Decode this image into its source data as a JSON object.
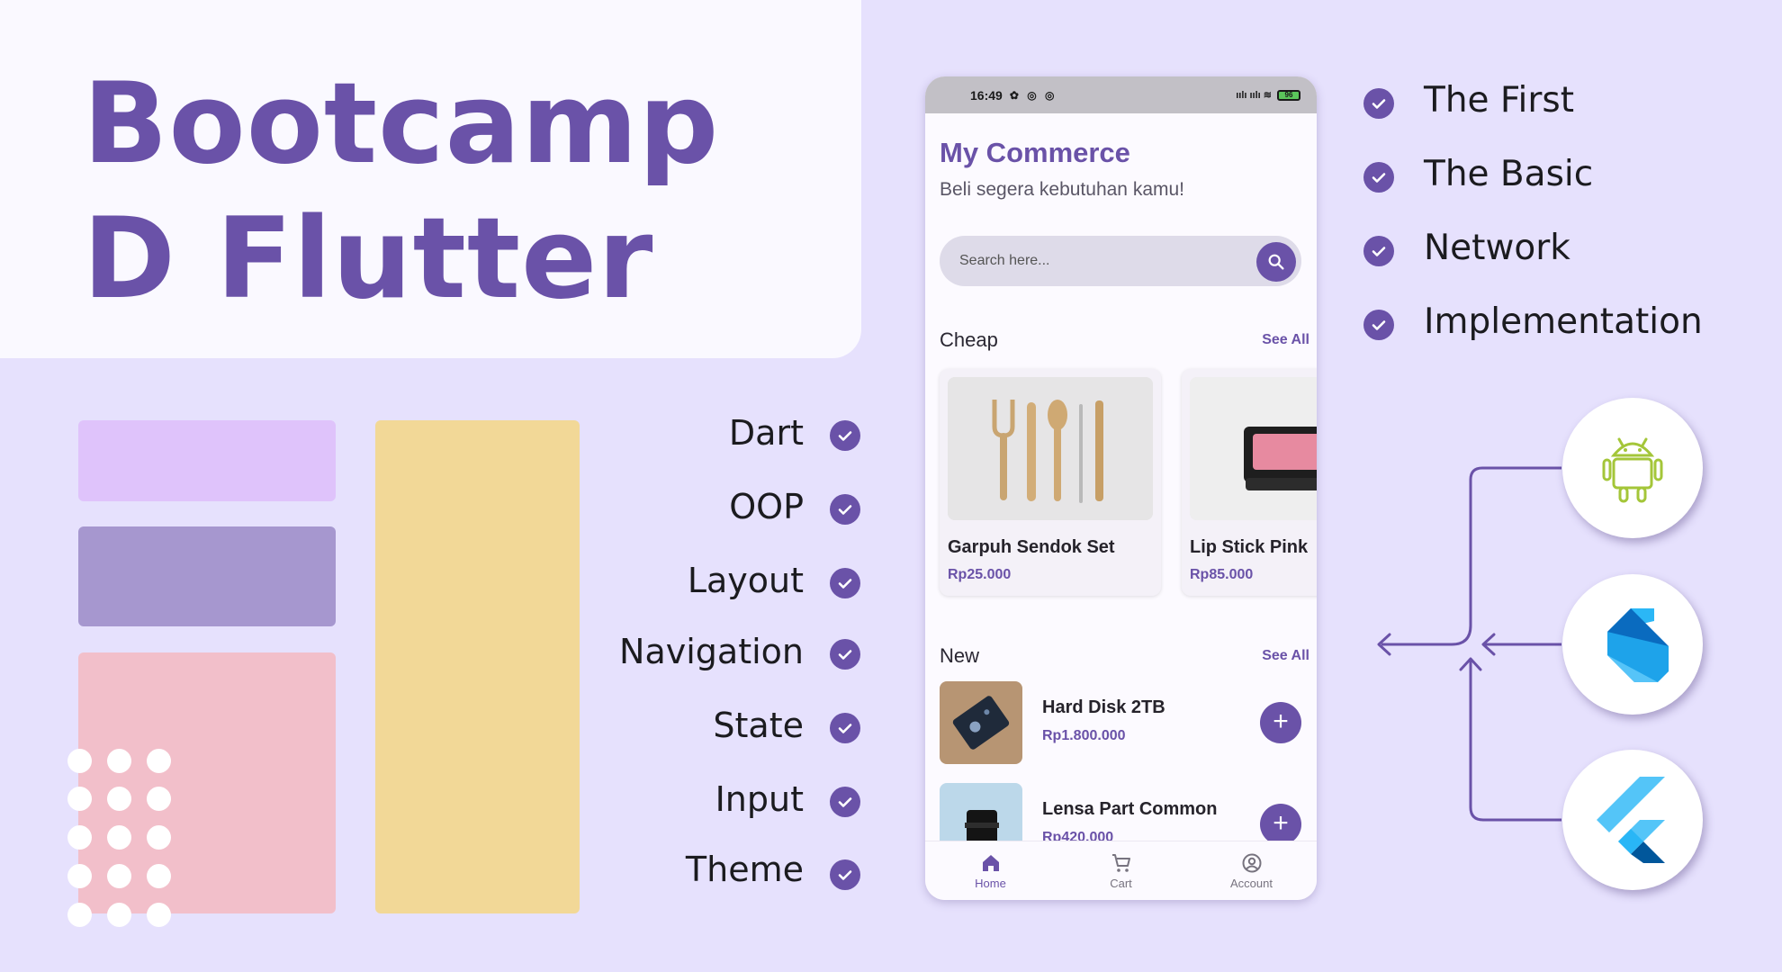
{
  "title": {
    "line1": "Bootcamp",
    "line2": "D Flutter"
  },
  "topics_left": [
    "Dart",
    "OOP",
    "Layout",
    "Navigation",
    "State",
    "Input",
    "Theme"
  ],
  "topics_right": [
    "The First",
    "The Basic",
    "Network",
    "Implementation"
  ],
  "phone": {
    "status_time": "16:49",
    "status_icons": "✿ ◎ ◎",
    "signal": "ıılı ıılı ≋",
    "battery": "96",
    "app_title": "My Commerce",
    "app_subtitle": "Beli segera kebutuhan kamu!",
    "search_placeholder": "Search here...",
    "cheap": {
      "title": "Cheap",
      "see_all": "See All",
      "items": [
        {
          "name": "Garpuh Sendok Set",
          "price": "Rp25.000"
        },
        {
          "name": "Lip Stick Pink",
          "price": "Rp85.000"
        }
      ]
    },
    "new": {
      "title": "New",
      "see_all": "See All",
      "items": [
        {
          "name": "Hard Disk 2TB",
          "price": "Rp1.800.000"
        },
        {
          "name": "Lensa Part Common",
          "price": "Rp420.000"
        }
      ]
    },
    "nav": [
      {
        "label": "Home",
        "icon": "home-icon"
      },
      {
        "label": "Cart",
        "icon": "cart-icon"
      },
      {
        "label": "Account",
        "icon": "account-icon"
      }
    ]
  },
  "tech_icons": [
    "android-icon",
    "dart-icon",
    "flutter-icon"
  ],
  "colors": {
    "accent": "#6a52a8",
    "background": "#e6e1fd",
    "android": "#a4c639",
    "dart": "#0175c2",
    "flutter": "#54c5f8"
  }
}
